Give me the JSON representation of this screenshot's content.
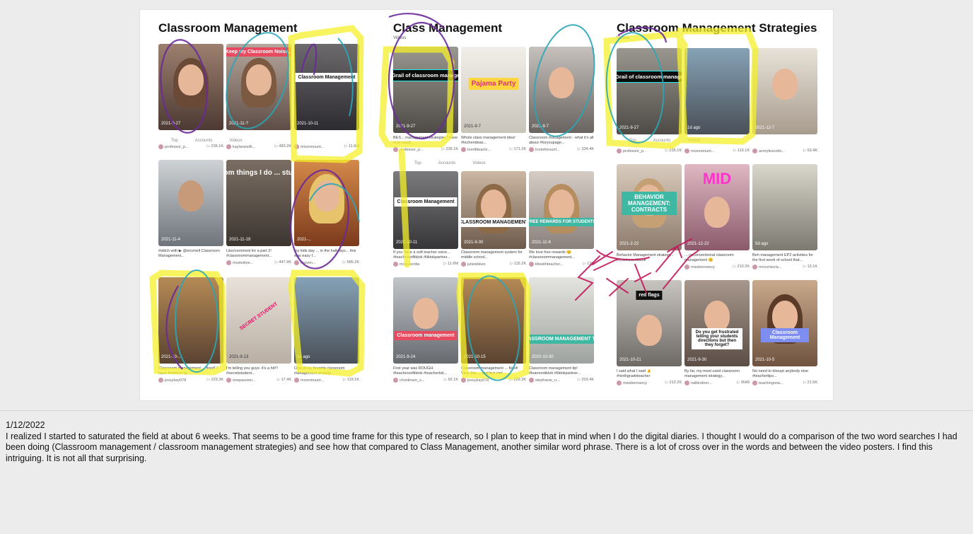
{
  "board": {
    "columns": [
      {
        "title": "Classroom Management",
        "subtitle": "",
        "tabs": [
          "Top",
          "Accounts",
          "Videos"
        ],
        "rows": [
          [
            {
              "date": "2021-9-27",
              "overlay": "",
              "caption": "",
              "user": "professor_p...",
              "views": "▷ 235.1K"
            },
            {
              "date": "2021-11-?",
              "overlay": "Keep my Classroom Noise...",
              "caption": "",
              "user": "kaylaranolk...",
              "views": "▷ 483.2K"
            },
            {
              "date": "2021-10-11",
              "overlay": "Classroom Management",
              "caption": "",
              "user": "movomount...",
              "views": "▷ 11.6M"
            }
          ],
          [
            {
              "date": "2021-11-4",
              "overlay": "",
              "caption": "#stitch with ▶ @envmell Classroom Management...",
              "user": "",
              "views": ""
            },
            {
              "date": "2021-11-19",
              "overlay": "Random things I do ... students",
              "caption": "Like/comment for a part 2! #classroommanagement...",
              "user": "mssteitioe...",
              "views": "▷ 447.9K"
            },
            {
              "date": "2021-...",
              "overlay": "",
              "caption": "my kids day ... in the hallways... this was easy f...",
              "user": "rhaven...",
              "views": "▷ 585.2K"
            }
          ],
          [
            {
              "date": "2021-10-...",
              "overlay": "",
              "caption": "Classroom management ... fixed! I have finished my ...",
              "user": "jessykay078",
              "views": "▷ 229.3K"
            },
            {
              "date": "2021-9-13",
              "overlay": "SECRET STUDENT",
              "caption": "I'm telling you guys- it's a hit!!! #secretstudent...",
              "user": "onepassion...",
              "views": "▷ 17.4K"
            },
            {
              "date": "1d ago",
              "overlay": "",
              "caption": "One of my favorite classroom management strategi...",
              "user": "movomount...",
              "views": "▷ 119.1K"
            }
          ]
        ]
      },
      {
        "title": "Class Management",
        "subtitle": "Videos",
        "tabs": [
          "Top",
          "Accounts",
          "Videos"
        ],
        "rows": [
          [
            {
              "date": "2021-9-27",
              "overlay": "Holy Grail of classroom management",
              "caption": "BES... management strategies I have ever used...",
              "user": "professor_p...",
              "views": "▷ 235.1K"
            },
            {
              "date": "2021-9-7",
              "overlay": "Pajama Party",
              "caption": "Whole class management idea! #techerideas...",
              "user": "tornfitteachi...",
              "views": "▷ 171.2K"
            },
            {
              "date": "2021-9-7",
              "overlay": "",
              "caption": "Classroom management - what it's all about #foryoupage...",
              "user": "funinthesunf...",
              "views": "▷ 324.4K"
            }
          ],
          [
            {
              "date": "2021-10-11",
              "overlay": "Classroom Management",
              "caption": "If you have a soft teacher voice... #teachersoftiktok #tiktokpartner...",
              "user": "mcqueenbe",
              "views": "▷ 11.6M"
            },
            {
              "date": "2021-9-30",
              "overlay": "CLASSROOM MANAGEMENT",
              "caption": "Classroom management system for middle school...",
              "user": "juliestokes",
              "views": "▷ 115.2K"
            },
            {
              "date": "2021-11-6",
              "overlay": "FREE REWARDS FOR STUDENTS",
              "caption": "We love free rewards 😊 #classroommanagement...",
              "user": "lifewithteacher...",
              "views": "▷ 13K"
            }
          ],
          [
            {
              "date": "2021-9-24",
              "overlay": "Classroom management",
              "caption": "First year was ROUGH. #teachersoftiktok #teachertok...",
              "user": "christinam_s...",
              "views": "▷ 92.1K"
            },
            {
              "date": "2021-10-15",
              "overlay": "",
              "caption": "Classroom management ... fixed! View this ... and but can'...",
              "user": "jessykay078",
              "views": "▷ 229.3K"
            },
            {
              "date": "2020-10-30",
              "overlay": "CLASSROOM MANAGEMENT TIP!",
              "caption": "Classroom management tip! #learnontiktok #tiktokpartner...",
              "user": "stephanie_n...",
              "views": "▷ 203.4K"
            }
          ]
        ]
      },
      {
        "title": "Classroom Management Strategies",
        "subtitle": "Videos",
        "tabs": [
          "Top",
          "Accounts",
          "Videos"
        ],
        "rows": [
          [
            {
              "date": "2021-9-27",
              "overlay": "Holy Grail of classroom management",
              "caption": "",
              "user": "professor_p...",
              "views": "▷ 235.1K"
            },
            {
              "date": "1d ago",
              "overlay": "",
              "caption": "",
              "user": "movomount...",
              "views": "▷ 119.1K"
            },
            {
              "date": "2021-12-7",
              "overlay": "",
              "caption": "",
              "user": "avorylescotto...",
              "views": "▷ 63.4K"
            }
          ],
          [
            {
              "date": "2021-2-22",
              "overlay": "BEHAVIOR MANAGEMENT: CONTRACTS",
              "caption": "Behavior Management strategy... #teachersoftiktok",
              "user": "missbernancy",
              "views": ""
            },
            {
              "date": "2021-12-22",
              "overlay": "MID",
              "caption": "... unconventional classroom management 😊",
              "user": "missbernancy",
              "views": "▷ 210.2K"
            },
            {
              "date": "5d ago",
              "overlay": "",
              "caption": "Beh management EP2 activities for the first week of school that...",
              "user": "mrcumiscla...",
              "views": "▷ 13.1K"
            }
          ],
          [
            {
              "date": "2021-10-21",
              "overlay": "red flags",
              "caption": "I said what I said 🤞 #ninthgradeteacher",
              "user": "missbernancy",
              "views": "▷ 210.2K"
            },
            {
              "date": "2021-9-30",
              "overlay": "Do you get frustrated telling your students directions but then they forget?",
              "caption": "By far, my most used classroom management strategy...",
              "user": "nalkindom...",
              "views": "▷ 9549"
            },
            {
              "date": "2021-10-5",
              "overlay": "Classroom Management",
              "caption": "No need to disrupt anybody else #teachertips...",
              "user": "teachingona...",
              "views": "▷ 21.5K"
            }
          ]
        ]
      }
    ]
  },
  "journal": {
    "date": "1/12/2022",
    "text": "I realized I started to saturated the field at about 6 weeks. That seems to be a good time frame for this type of research, so I plan to keep that in mind when I do the digital diaries. I thought I would do a comparison of the two word searches I had been doing (Classroom management / classroom management strategies) and see how that compared to Class Management, another similar word phrase. There is a lot of cross over in the words and between the video posters. I find this intriguing. It is not all that surprising."
  },
  "colors": {
    "highlight_yellow": "#f4f02a",
    "ink_purple": "#6a2a9a",
    "ink_teal": "#2aa6b8",
    "ink_magenta": "#c2185b"
  }
}
